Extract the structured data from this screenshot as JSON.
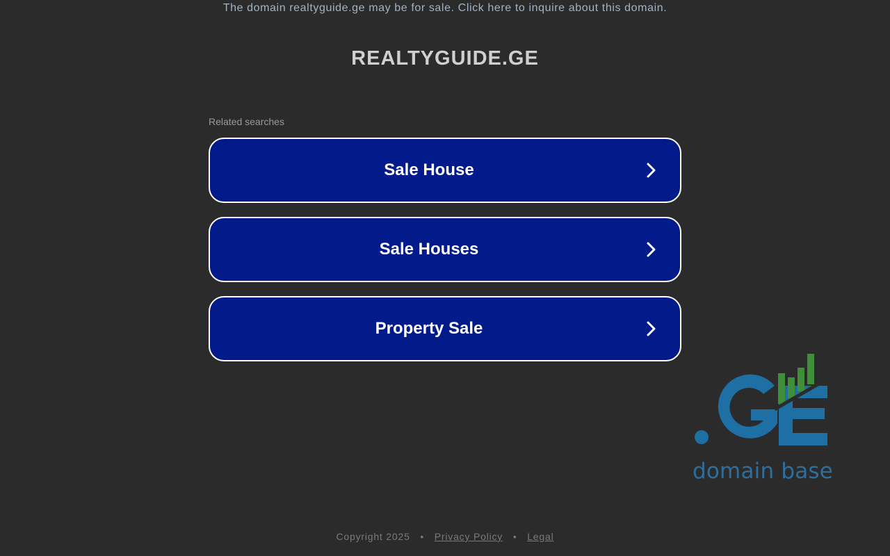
{
  "banner": {
    "text": "The domain realtyguide.ge may be for sale. Click here to inquire about this domain."
  },
  "site": {
    "title": "REALTYGUIDE.GE"
  },
  "related": {
    "label": "Related searches",
    "items": [
      {
        "label": "Sale House",
        "icon": "chevron-right-icon"
      },
      {
        "label": "Sale Houses",
        "icon": "chevron-right-icon"
      },
      {
        "label": "Property Sale",
        "icon": "chevron-right-icon"
      }
    ]
  },
  "logo": {
    "caption": "domain base",
    "colors": {
      "blue": "#1e6fa3",
      "green": "#3f8f3a",
      "caption": "#2f6e9c"
    }
  },
  "footer": {
    "copyright": "Copyright 2025",
    "separator": "•",
    "privacy": "Privacy Policy",
    "legal": "Legal"
  },
  "colors": {
    "background": "#2b2b2b",
    "button_bg": "#021a8a",
    "button_border": "#ffffff"
  }
}
